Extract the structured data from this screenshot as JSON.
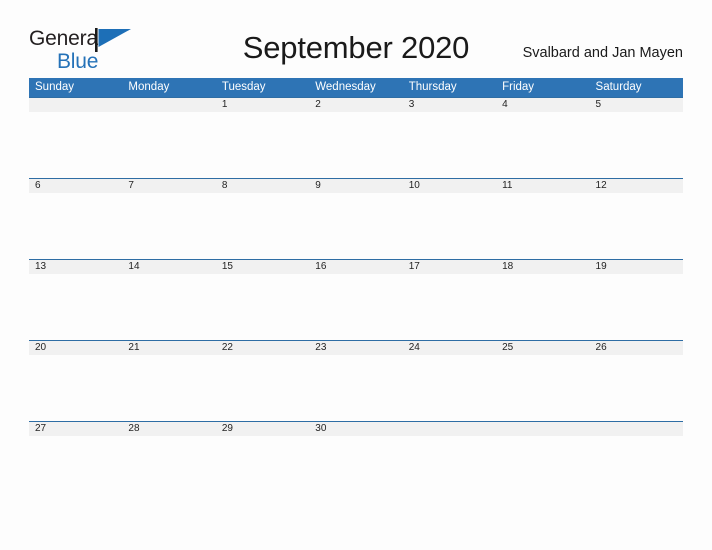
{
  "brand": {
    "name_part1": "General",
    "name_part2": "Blue",
    "flag_icon": "blue-flag-triangle",
    "color_text": "#231f20",
    "color_accent": "#2572b8"
  },
  "header": {
    "title": "September 2020",
    "location": "Svalbard and Jan Mayen"
  },
  "calendar": {
    "accent_color": "#2e74b5",
    "row_line_color": "#2e6da4",
    "day_strip_color": "#f1f1f1",
    "weekdays": [
      "Sunday",
      "Monday",
      "Tuesday",
      "Wednesday",
      "Thursday",
      "Friday",
      "Saturday"
    ],
    "weeks": [
      [
        "",
        "",
        "1",
        "2",
        "3",
        "4",
        "5"
      ],
      [
        "6",
        "7",
        "8",
        "9",
        "10",
        "11",
        "12"
      ],
      [
        "13",
        "14",
        "15",
        "16",
        "17",
        "18",
        "19"
      ],
      [
        "20",
        "21",
        "22",
        "23",
        "24",
        "25",
        "26"
      ],
      [
        "27",
        "28",
        "29",
        "30",
        "",
        "",
        ""
      ]
    ]
  }
}
